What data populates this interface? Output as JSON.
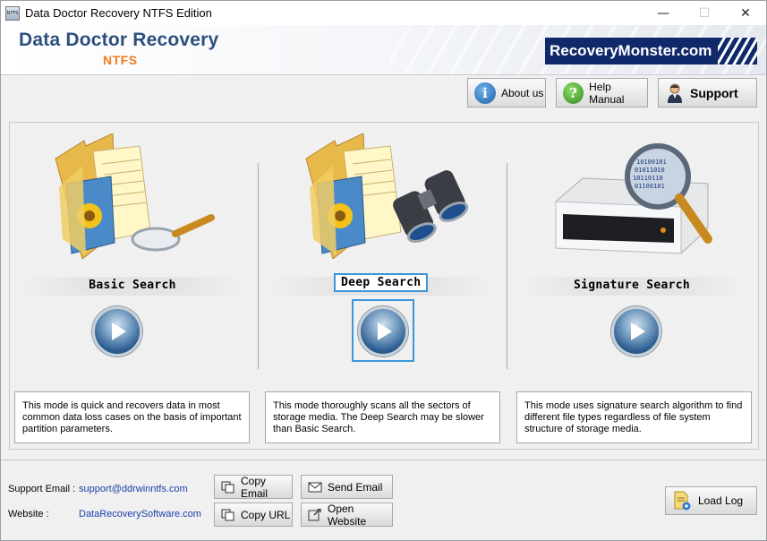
{
  "window": {
    "title": "Data Doctor Recovery NTFS Edition",
    "icon_text": "NTFS",
    "controls": {
      "minimize": "—",
      "maximize": "☐",
      "close": "✕"
    }
  },
  "banner": {
    "title": "Data Doctor Recovery",
    "subtitle": "NTFS",
    "logo_text": "RecoveryMonster.com",
    "title_color": "#2d4f7c",
    "subtitle_color": "#f07b1e",
    "logo_bg": "#10296a"
  },
  "toolbar": {
    "about": "About us",
    "help": "Help Manual",
    "support": "Support"
  },
  "modes": [
    {
      "label": "Basic Search",
      "description": "This mode is quick and recovers data in most common data loss cases on the basis of important partition parameters.",
      "icon": "folder-magnifier-icon"
    },
    {
      "label": "Deep Search",
      "description": "This mode thoroughly scans all the sectors of storage media. The Deep Search may be slower than Basic Search.",
      "icon": "folder-binoculars-icon"
    },
    {
      "label": "Signature Search",
      "description": "This mode uses signature search algorithm to find different file types regardless of file system structure of storage media.",
      "icon": "drive-magnifier-icon"
    }
  ],
  "footer": {
    "support_label": "Support Email :",
    "support_email": "support@ddrwinntfs.com",
    "website_label": "Website :",
    "website": "DataRecoverySoftware.com",
    "copy_email": "Copy Email",
    "send_email": "Send Email",
    "copy_url": "Copy URL",
    "open_website": "Open Website",
    "load_log": "Load Log"
  }
}
